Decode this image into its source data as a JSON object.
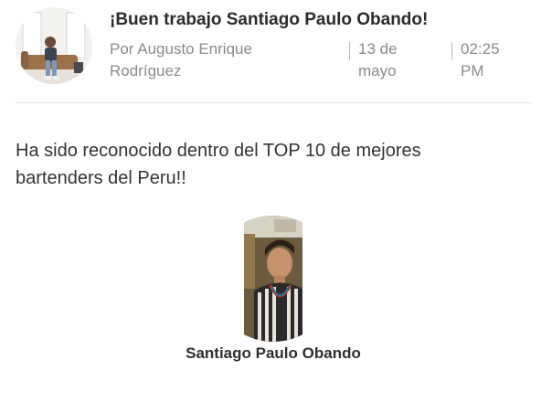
{
  "post": {
    "title": "¡Buen trabajo Santiago Paulo Obando!",
    "author": "Por Augusto Enrique Rodríguez",
    "date": "13 de mayo",
    "time": "02:25 PM"
  },
  "message": "Ha sido reconocido dentro del TOP 10 de mejores bartenders del Peru!!",
  "recipient": {
    "name": "Santiago Paulo Obando"
  }
}
